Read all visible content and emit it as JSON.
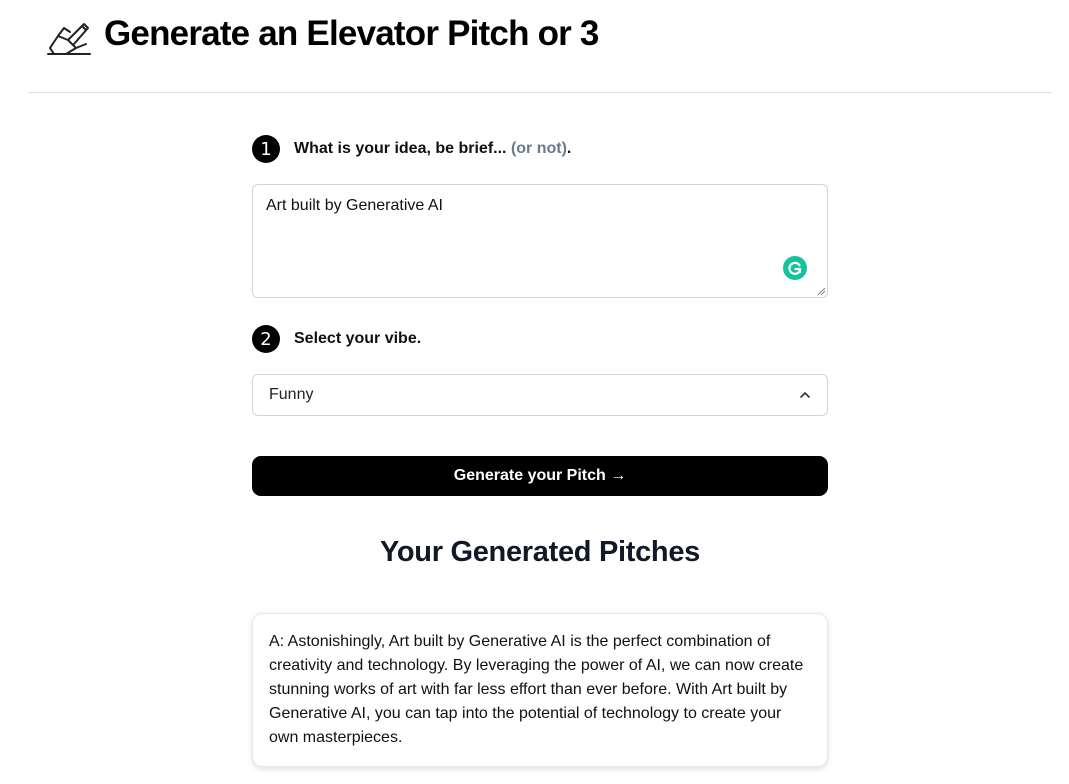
{
  "header": {
    "title": "Generate an Elevator Pitch or 3",
    "logo_icon": "writing-hand-icon"
  },
  "step1": {
    "number": "1",
    "label": "What is your idea, be brief...",
    "label_muted": "(or not)",
    "label_suffix": ".",
    "idea_value": "Art built by Generative AI",
    "grammarly_icon": "grammarly-icon"
  },
  "step2": {
    "number": "2",
    "label": "Select your vibe.",
    "selected_option": "Funny",
    "chevron_icon": "chevron-up-icon"
  },
  "generate_button": {
    "label": "Generate your Pitch →"
  },
  "results": {
    "title": "Your Generated Pitches",
    "pitches": [
      {
        "text": "A: Astonishingly, Art built by Generative AI is the perfect combination of creativity and technology. By leveraging the power of AI, we can now create stunning works of art with far less effort than ever before. With Art built by Generative AI, you can tap into the potential of technology to create your own masterpieces."
      }
    ]
  },
  "colors": {
    "button_bg": "#000000",
    "muted_text": "#6b7a8c",
    "grammarly": "#15c39a"
  }
}
